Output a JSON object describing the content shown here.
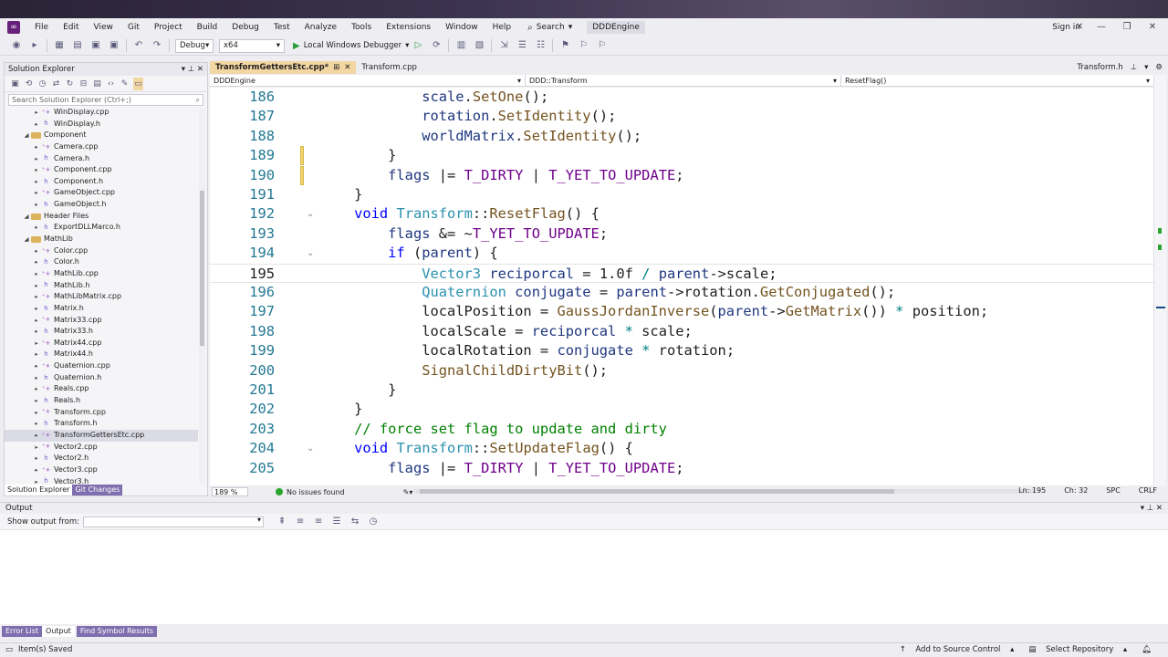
{
  "menubar": {
    "items": [
      "File",
      "Edit",
      "View",
      "Git",
      "Project",
      "Build",
      "Debug",
      "Test",
      "Analyze",
      "Tools",
      "Extensions",
      "Window",
      "Help"
    ],
    "search_label": "Search",
    "project_name": "DDDEngine",
    "sign_in": "Sign in"
  },
  "toolbar": {
    "config": "Debug",
    "platform": "x64",
    "run_label": "Local Windows Debugger"
  },
  "solution_explorer": {
    "title": "Solution Explorer",
    "search_placeholder": "Search Solution Explorer (Ctrl+;)",
    "items": [
      {
        "label": "WinDisplay.cpp",
        "depth": 3,
        "kind": "cpp",
        "arrow": "▸"
      },
      {
        "label": "WinDisplay.h",
        "depth": 3,
        "kind": "h",
        "arrow": "▸"
      },
      {
        "label": "Component",
        "depth": 2,
        "kind": "folder",
        "arrow": "◢"
      },
      {
        "label": "Camera.cpp",
        "depth": 3,
        "kind": "cpp",
        "arrow": "▸"
      },
      {
        "label": "Camera.h",
        "depth": 3,
        "kind": "h",
        "arrow": "▸"
      },
      {
        "label": "Component.cpp",
        "depth": 3,
        "kind": "cpp",
        "arrow": "▸"
      },
      {
        "label": "Component.h",
        "depth": 3,
        "kind": "h",
        "arrow": "▸"
      },
      {
        "label": "GameObject.cpp",
        "depth": 3,
        "kind": "cpp",
        "arrow": "▸"
      },
      {
        "label": "GameObject.h",
        "depth": 3,
        "kind": "h",
        "arrow": "▸"
      },
      {
        "label": "Header Files",
        "depth": 2,
        "kind": "folder",
        "arrow": "◢"
      },
      {
        "label": "ExportDLLMarco.h",
        "depth": 3,
        "kind": "h",
        "arrow": "▸"
      },
      {
        "label": "MathLib",
        "depth": 2,
        "kind": "folder",
        "arrow": "◢"
      },
      {
        "label": "Color.cpp",
        "depth": 3,
        "kind": "cpp",
        "arrow": "▸"
      },
      {
        "label": "Color.h",
        "depth": 3,
        "kind": "h",
        "arrow": "▸"
      },
      {
        "label": "MathLib.cpp",
        "depth": 3,
        "kind": "cpp",
        "arrow": "▸"
      },
      {
        "label": "MathLib.h",
        "depth": 3,
        "kind": "h",
        "arrow": "▸"
      },
      {
        "label": "MathLibMatrix.cpp",
        "depth": 3,
        "kind": "cpp",
        "arrow": "▸"
      },
      {
        "label": "Matrix.h",
        "depth": 3,
        "kind": "h",
        "arrow": "▸"
      },
      {
        "label": "Matrix33.cpp",
        "depth": 3,
        "kind": "cpp",
        "arrow": "▸"
      },
      {
        "label": "Matrix33.h",
        "depth": 3,
        "kind": "h",
        "arrow": "▸"
      },
      {
        "label": "Matrix44.cpp",
        "depth": 3,
        "kind": "cpp",
        "arrow": "▸"
      },
      {
        "label": "Matrix44.h",
        "depth": 3,
        "kind": "h",
        "arrow": "▸"
      },
      {
        "label": "Quaternion.cpp",
        "depth": 3,
        "kind": "cpp",
        "arrow": "▸"
      },
      {
        "label": "Quaternion.h",
        "depth": 3,
        "kind": "h",
        "arrow": "▸"
      },
      {
        "label": "Reals.cpp",
        "depth": 3,
        "kind": "cpp",
        "arrow": "▸"
      },
      {
        "label": "Reals.h",
        "depth": 3,
        "kind": "h",
        "arrow": "▸"
      },
      {
        "label": "Transform.cpp",
        "depth": 3,
        "kind": "cpp",
        "arrow": "▸"
      },
      {
        "label": "Transform.h",
        "depth": 3,
        "kind": "h",
        "arrow": "▸"
      },
      {
        "label": "TransformGettersEtc.cpp",
        "depth": 3,
        "kind": "cpp",
        "arrow": "▸",
        "selected": true
      },
      {
        "label": "Vector2.cpp",
        "depth": 3,
        "kind": "cpp",
        "arrow": "▸"
      },
      {
        "label": "Vector2.h",
        "depth": 3,
        "kind": "h",
        "arrow": "▸"
      },
      {
        "label": "Vector3.cpp",
        "depth": 3,
        "kind": "cpp",
        "arrow": "▸"
      },
      {
        "label": "Vector3.h",
        "depth": 3,
        "kind": "h",
        "arrow": "▸"
      }
    ],
    "tabs": [
      "Solution Explorer",
      "Git Changes"
    ]
  },
  "editor": {
    "tabs": [
      {
        "label": "TransformGettersEtc.cpp*",
        "active": true
      },
      {
        "label": "Transform.cpp",
        "active": false
      }
    ],
    "right_tab": "Transform.h",
    "nav_project": "DDDEngine",
    "nav_scope": "DDD::Transform",
    "nav_member": "ResetFlag()",
    "current_line": 195,
    "lines": [
      {
        "n": "186",
        "tokens": [
          [
            "            ",
            ""
          ],
          [
            "scale",
            "lv"
          ],
          [
            ".",
            ""
          ],
          [
            "SetOne",
            "fn"
          ],
          [
            "();",
            ""
          ]
        ]
      },
      {
        "n": "187",
        "tokens": [
          [
            "            ",
            ""
          ],
          [
            "rotation",
            "lv"
          ],
          [
            ".",
            ""
          ],
          [
            "SetIdentity",
            "fn"
          ],
          [
            "();",
            ""
          ]
        ]
      },
      {
        "n": "188",
        "tokens": [
          [
            "            ",
            ""
          ],
          [
            "worldMatrix",
            "lv"
          ],
          [
            ".",
            ""
          ],
          [
            "SetIdentity",
            "fn"
          ],
          [
            "();",
            ""
          ]
        ]
      },
      {
        "n": "189",
        "tokens": [
          [
            "        }",
            ""
          ]
        ],
        "mark": true
      },
      {
        "n": "190",
        "tokens": [
          [
            "        ",
            ""
          ],
          [
            "flags",
            "lv"
          ],
          [
            " |= ",
            ""
          ],
          [
            "T_DIRTY",
            "mac"
          ],
          [
            " | ",
            ""
          ],
          [
            "T_YET_TO_UPDATE",
            "mac"
          ],
          [
            ";",
            ""
          ]
        ],
        "mark": true
      },
      {
        "n": "191",
        "tokens": [
          [
            "    }",
            ""
          ]
        ]
      },
      {
        "n": "192",
        "fold": true,
        "tokens": [
          [
            "    ",
            ""
          ],
          [
            "void",
            "kw"
          ],
          [
            " ",
            ""
          ],
          [
            "Transform",
            "ty"
          ],
          [
            "::",
            ""
          ],
          [
            "ResetFlag",
            "fn"
          ],
          [
            "() {",
            ""
          ]
        ]
      },
      {
        "n": "193",
        "tokens": [
          [
            "        ",
            ""
          ],
          [
            "flags",
            "lv"
          ],
          [
            " &= ~",
            ""
          ],
          [
            "T_YET_TO_UPDATE",
            "mac"
          ],
          [
            ";",
            ""
          ]
        ]
      },
      {
        "n": "194",
        "fold": true,
        "tokens": [
          [
            "        ",
            ""
          ],
          [
            "if",
            "kw"
          ],
          [
            " (",
            ""
          ],
          [
            "parent",
            "lv"
          ],
          [
            ") {",
            ""
          ]
        ]
      },
      {
        "n": "195",
        "tokens": [
          [
            "            ",
            ""
          ],
          [
            "Vector3",
            "ty"
          ],
          [
            " ",
            ""
          ],
          [
            "reciporcal",
            "lv"
          ],
          [
            " = 1.0f ",
            ""
          ],
          [
            "/",
            "op"
          ],
          [
            " ",
            ""
          ],
          [
            "parent",
            "lv"
          ],
          [
            "->scale;",
            ""
          ]
        ]
      },
      {
        "n": "196",
        "tokens": [
          [
            "            ",
            ""
          ],
          [
            "Quaternion",
            "ty"
          ],
          [
            " ",
            ""
          ],
          [
            "conjugate",
            "lv"
          ],
          [
            " = ",
            ""
          ],
          [
            "parent",
            "lv"
          ],
          [
            "->rotation.",
            ""
          ],
          [
            "GetConjugated",
            "fn"
          ],
          [
            "();",
            ""
          ]
        ]
      },
      {
        "n": "197",
        "tokens": [
          [
            "            localPosition = ",
            ""
          ],
          [
            "GaussJordanInverse",
            "fn"
          ],
          [
            "(",
            ""
          ],
          [
            "parent",
            "lv"
          ],
          [
            "->",
            ""
          ],
          [
            "GetMatrix",
            "fn"
          ],
          [
            "()) ",
            ""
          ],
          [
            "*",
            "op"
          ],
          [
            " position;",
            ""
          ]
        ]
      },
      {
        "n": "198",
        "tokens": [
          [
            "            localScale = ",
            ""
          ],
          [
            "reciporcal",
            "lv"
          ],
          [
            " ",
            ""
          ],
          [
            "*",
            "op"
          ],
          [
            " scale;",
            ""
          ]
        ]
      },
      {
        "n": "199",
        "tokens": [
          [
            "            localRotation = ",
            ""
          ],
          [
            "conjugate",
            "lv"
          ],
          [
            " ",
            ""
          ],
          [
            "*",
            "op"
          ],
          [
            " rotation;",
            ""
          ]
        ]
      },
      {
        "n": "200",
        "tokens": [
          [
            "            ",
            ""
          ],
          [
            "SignalChildDirtyBit",
            "fn"
          ],
          [
            "();",
            ""
          ]
        ]
      },
      {
        "n": "201",
        "tokens": [
          [
            "        }",
            ""
          ]
        ]
      },
      {
        "n": "202",
        "tokens": [
          [
            "    }",
            ""
          ]
        ]
      },
      {
        "n": "203",
        "tokens": [
          [
            "    ",
            ""
          ],
          [
            "// force set flag to update and dirty",
            "cm"
          ]
        ]
      },
      {
        "n": "204",
        "fold": true,
        "tokens": [
          [
            "    ",
            ""
          ],
          [
            "void",
            "kw"
          ],
          [
            " ",
            ""
          ],
          [
            "Transform",
            "ty"
          ],
          [
            "::",
            ""
          ],
          [
            "SetUpdateFlag",
            "fn"
          ],
          [
            "() {",
            ""
          ]
        ]
      },
      {
        "n": "205",
        "tokens": [
          [
            "        ",
            ""
          ],
          [
            "flags",
            "lv"
          ],
          [
            " |= ",
            ""
          ],
          [
            "T_DIRTY",
            "mac"
          ],
          [
            " | ",
            ""
          ],
          [
            "T_YET_TO_UPDATE",
            "mac"
          ],
          [
            ";",
            ""
          ]
        ]
      }
    ]
  },
  "editor_status": {
    "zoom": "189 %",
    "issues": "No issues found",
    "ln": "Ln: 195",
    "ch": "Ch: 32",
    "spc": "SPC",
    "crlf": "CRLF"
  },
  "output": {
    "title": "Output",
    "show_from": "Show output from:"
  },
  "bottom_tabs": [
    "Error List",
    "Output",
    "Find Symbol Results"
  ],
  "statusbar": {
    "left": "Item(s) Saved",
    "add_source": "Add to Source Control",
    "select_repo": "Select Repository"
  },
  "colors": {
    "keyword": "#0000ff",
    "type": "#2b91af",
    "function": "#74531f",
    "macro": "#6f008a",
    "comment": "#008000",
    "active_tab": "#f3d7a3"
  }
}
